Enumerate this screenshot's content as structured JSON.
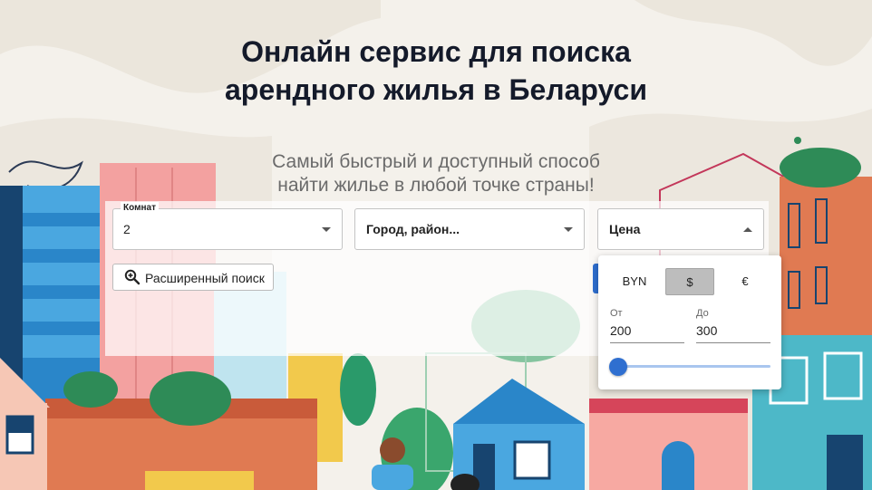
{
  "hero": {
    "title_line1": "Онлайн сервис для поиска",
    "title_line2": "арендного жилья в Беларуси",
    "subtitle_line1": "Самый быстрый и доступный способ",
    "subtitle_line2": "найти жилье в любой точке страны!"
  },
  "search": {
    "rooms": {
      "label": "Комнат",
      "value": "2"
    },
    "city": {
      "placeholder": "Город, район..."
    },
    "price": {
      "label": "Цена"
    },
    "advanced_label": "Расширенный поиск"
  },
  "price_popup": {
    "currencies": [
      "BYN",
      "$",
      "€"
    ],
    "selected_currency": "$",
    "from_label": "От",
    "from_value": "200",
    "to_label": "До",
    "to_value": "300"
  },
  "colors": {
    "accent": "#2f6fd0",
    "title": "#141a2a",
    "background": "#f4f1eb"
  },
  "icons": [
    "zoom-in-icon",
    "chevron-down-icon",
    "chevron-up-icon"
  ]
}
